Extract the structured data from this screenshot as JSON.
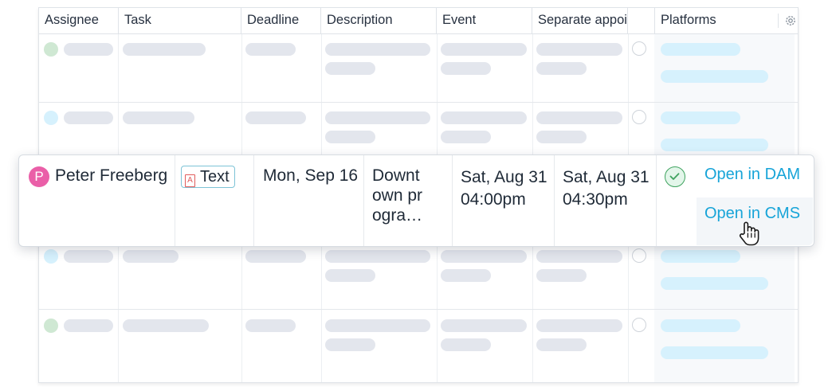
{
  "columns": {
    "assignee": "Assignee",
    "task": "Task",
    "deadline": "Deadline",
    "description": "Description",
    "event": "Event",
    "separate": "Separate appoi",
    "platforms": "Platforms"
  },
  "icons": {
    "settings": "gear-icon",
    "done": "check-circle-icon",
    "cursor": "hand-pointer-icon",
    "task_type": "document-icon"
  },
  "colors": {
    "avatar": "#ea5fa8",
    "link": "#17a4d8",
    "check": "#3fa35f"
  },
  "highlight_row": {
    "avatar_letter": "P",
    "assignee": "Peter Freeberg",
    "task_type_icon_letter": "A",
    "task": "Text",
    "deadline": "Mon, Sep 16",
    "description": "Downt own progra…",
    "event_date": "Sat, Aug 31",
    "event_time": "04:00pm",
    "separate_date": "Sat, Aug 31",
    "separate_time": "04:30pm",
    "completed": true,
    "open_dam": "Open in DAM",
    "open_cms": "Open in CMS"
  }
}
